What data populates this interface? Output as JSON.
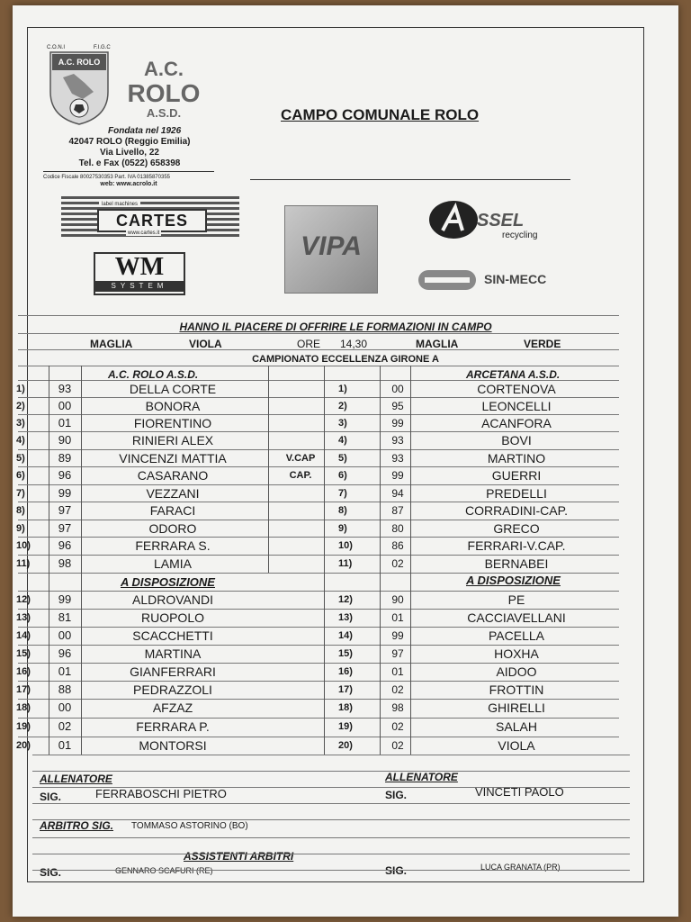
{
  "club": {
    "coni": "C.O.N.I",
    "figc": "F.I.G.C",
    "badge_text": "A.C. ROLO",
    "badge_sub": "A.S.D.",
    "name_line1": "A.C.",
    "name_line2": "ROLO",
    "name_line3": "A.S.D.",
    "founded": "Fondata nel 1926",
    "addr1": "42047 ROLO (Reggio Emilia)",
    "addr2": "Via Livello, 22",
    "phone": "Tel. e Fax (0522) 658398",
    "tax": "Codice Fiscale 80027530353     Part. IVA 01385870355",
    "web": "web: www.acrolo.it"
  },
  "venue": "CAMPO COMUNALE ROLO",
  "sponsors": {
    "cartes_top": "label machines",
    "cartes": "CARTES",
    "cartes_url": "www.cartes.it",
    "wm": "WM",
    "wm_sub": "SYSTEM",
    "vipa": "VIPA",
    "assel": "SSEL",
    "assel_sub": "recycling",
    "sinmecc": "SIN-MECC"
  },
  "header": "HANNO IL PIACERE DI OFFRIRE LE FORMAZIONI IN CAMPO",
  "info": {
    "maglia_label_l": "MAGLIA",
    "maglia_value_l": "VIOLA",
    "ore_label": "ORE",
    "ore_value": "14,30",
    "maglia_label_r": "MAGLIA",
    "maglia_value_r": "VERDE",
    "championship": "CAMPIONATO ECCELLENZA GIRONE A"
  },
  "home": {
    "team": "A.C. ROLO A.S.D."
  },
  "away": {
    "team": "ARCETANA A.S.D."
  },
  "bench_title": "A DISPOSIZIONE",
  "players": [
    {
      "n": "1)",
      "hs": "93",
      "hn": "DELLA CORTE",
      "role": "",
      "as": "00",
      "an": "CORTENOVA"
    },
    {
      "n": "2)",
      "hs": "00",
      "hn": "BONORA",
      "role": "",
      "as": "95",
      "an": "LEONCELLI"
    },
    {
      "n": "3)",
      "hs": "01",
      "hn": "FIORENTINO",
      "role": "",
      "as": "99",
      "an": "ACANFORA"
    },
    {
      "n": "4)",
      "hs": "90",
      "hn": "RINIERI ALEX",
      "role": "",
      "as": "93",
      "an": "BOVI"
    },
    {
      "n": "5)",
      "hs": "89",
      "hn": "VINCENZI MATTIA",
      "role": "V.CAP",
      "as": "93",
      "an": "MARTINO"
    },
    {
      "n": "6)",
      "hs": "96",
      "hn": "CASARANO",
      "role": "CAP.",
      "as": "99",
      "an": "GUERRI"
    },
    {
      "n": "7)",
      "hs": "99",
      "hn": "VEZZANI",
      "role": "",
      "as": "94",
      "an": "PREDELLI"
    },
    {
      "n": "8)",
      "hs": "97",
      "hn": "FARACI",
      "role": "",
      "as": "87",
      "an": "CORRADINI-CAP."
    },
    {
      "n": "9)",
      "hs": "97",
      "hn": "ODORO",
      "role": "",
      "as": "80",
      "an": "GRECO"
    },
    {
      "n": "10)",
      "hs": "96",
      "hn": "FERRARA S.",
      "role": "",
      "as": "86",
      "an": "FERRARI-V.CAP."
    },
    {
      "n": "11)",
      "hs": "98",
      "hn": "LAMIA",
      "role": "",
      "as": "02",
      "an": "BERNABEI"
    }
  ],
  "bench": [
    {
      "n": "12)",
      "hs": "99",
      "hn": "ALDROVANDI",
      "as": "90",
      "an": "PE"
    },
    {
      "n": "13)",
      "hs": "81",
      "hn": "RUOPOLO",
      "as": "01",
      "an": "CACCIAVELLANI"
    },
    {
      "n": "14)",
      "hs": "00",
      "hn": "SCACCHETTI",
      "as": "99",
      "an": "PACELLA"
    },
    {
      "n": "15)",
      "hs": "96",
      "hn": "MARTINA",
      "as": "97",
      "an": "HOXHA"
    },
    {
      "n": "16)",
      "hs": "01",
      "hn": "GIANFERRARI",
      "as": "01",
      "an": "AIDOO"
    },
    {
      "n": "17)",
      "hs": "88",
      "hn": "PEDRAZZOLI",
      "as": "02",
      "an": "FROTTIN"
    },
    {
      "n": "18)",
      "hs": "00",
      "hn": "AFZAZ",
      "as": "98",
      "an": "GHIRELLI"
    },
    {
      "n": "19)",
      "hs": "02",
      "hn": "FERRARA P.",
      "as": "02",
      "an": "SALAH"
    },
    {
      "n": "20)",
      "hs": "01",
      "hn": "MONTORSI",
      "as": "02",
      "an": "VIOLA"
    }
  ],
  "footer": {
    "coach_label": "ALLENATORE",
    "sig": "SIG.",
    "home_coach": "FERRABOSCHI PIETRO",
    "away_coach": "VINCETI PAOLO",
    "referee_label": "ARBITRO SIG.",
    "referee": "TOMMASO ASTORINO (BO)",
    "assistants_label": "ASSISTENTI ARBITRI",
    "assistant1": "GENNARO SCAFURI (RE)",
    "assistant2": "LUCA GRANATA (PR)"
  }
}
